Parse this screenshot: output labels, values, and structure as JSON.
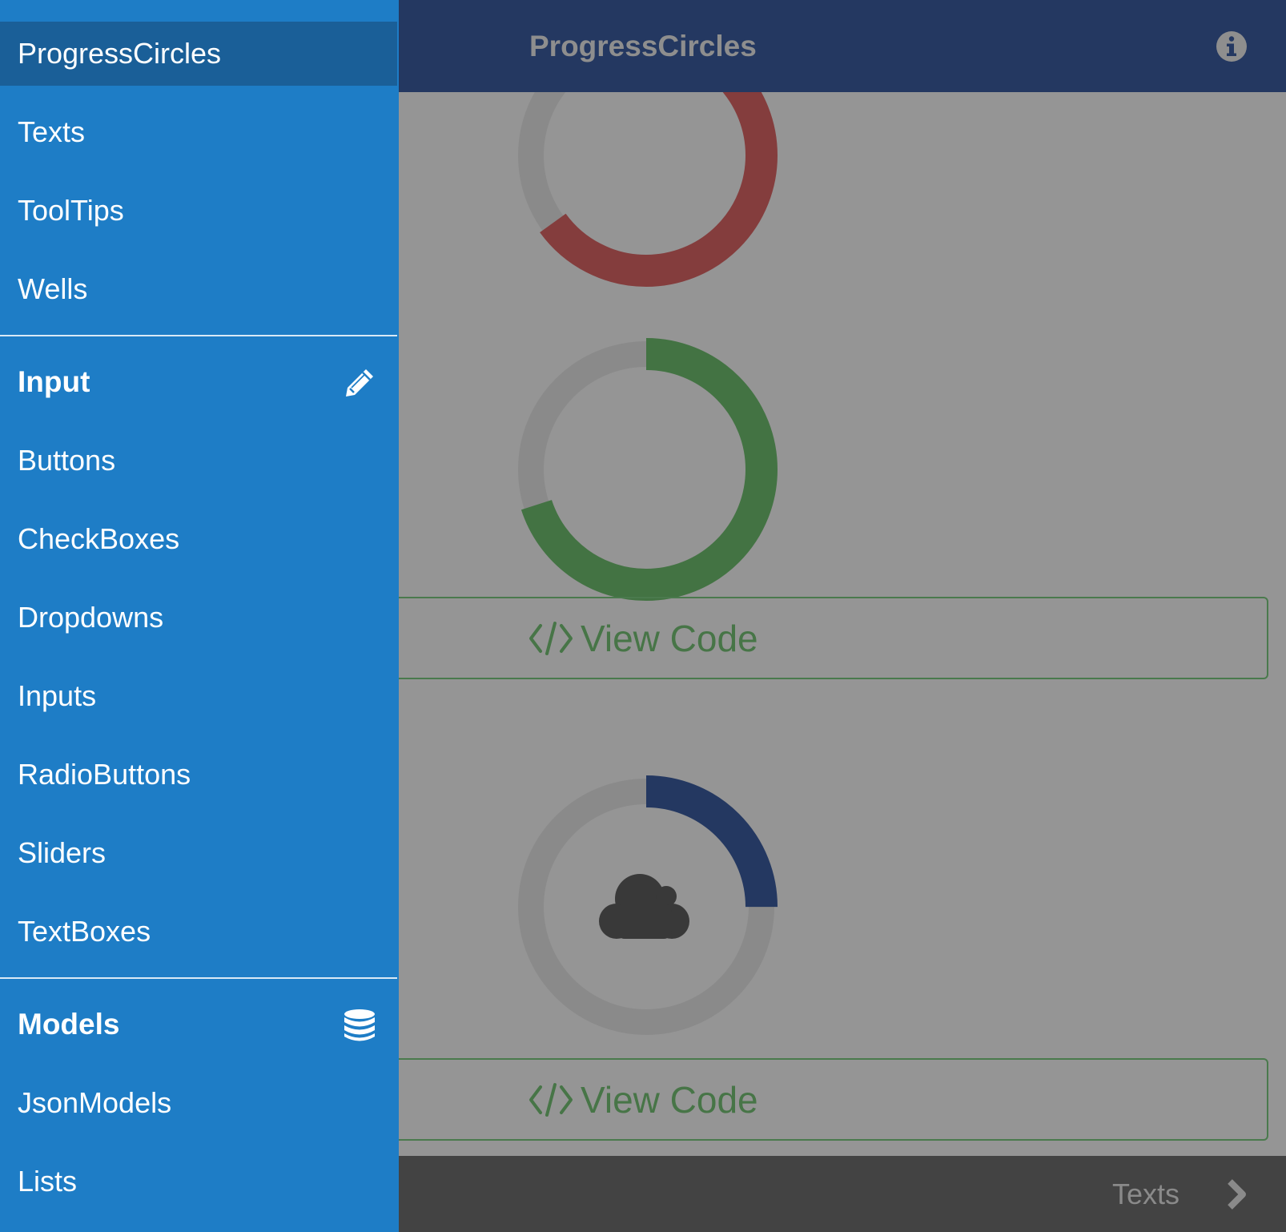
{
  "header": {
    "title": "ProgressCircles",
    "info_icon": "info-circle-icon"
  },
  "progress_circles": [
    {
      "value_fraction": 0.65,
      "color": "#843d3d",
      "track_color": "#8a8a8a",
      "icon": ""
    },
    {
      "value_fraction": 0.7,
      "color": "#437343",
      "track_color": "#8a8a8a",
      "icon": ""
    },
    {
      "value_fraction": 0.25,
      "color": "#243861",
      "track_color": "#8a8a8a",
      "icon": "cloud-icon"
    }
  ],
  "view_code_buttons": [
    {
      "label": "View Code",
      "icon": "code-icon"
    },
    {
      "label": "View Code",
      "icon": "code-icon"
    }
  ],
  "footer": {
    "next_label": "Texts",
    "next_icon": "chevron-right-icon"
  },
  "sidebar": {
    "items_top": [
      {
        "label": "ProgressCircles",
        "active": true
      },
      {
        "label": "Texts"
      },
      {
        "label": "ToolTips"
      },
      {
        "label": "Wells"
      }
    ],
    "input_section": {
      "title": "Input",
      "icon": "pencil-icon",
      "items": [
        "Buttons",
        "CheckBoxes",
        "Dropdowns",
        "Inputs",
        "RadioButtons",
        "Sliders",
        "TextBoxes"
      ]
    },
    "models_section": {
      "title": "Models",
      "icon": "database-icon",
      "items": [
        "JsonModels",
        "Lists"
      ]
    }
  },
  "colors": {
    "sidebar_bg": "#1e7dc6",
    "sidebar_active": "#1a5f98",
    "header_bg": "#243861",
    "overlay_bg": "#959595",
    "footer_bg": "#434343",
    "view_code_green": "#477547"
  }
}
